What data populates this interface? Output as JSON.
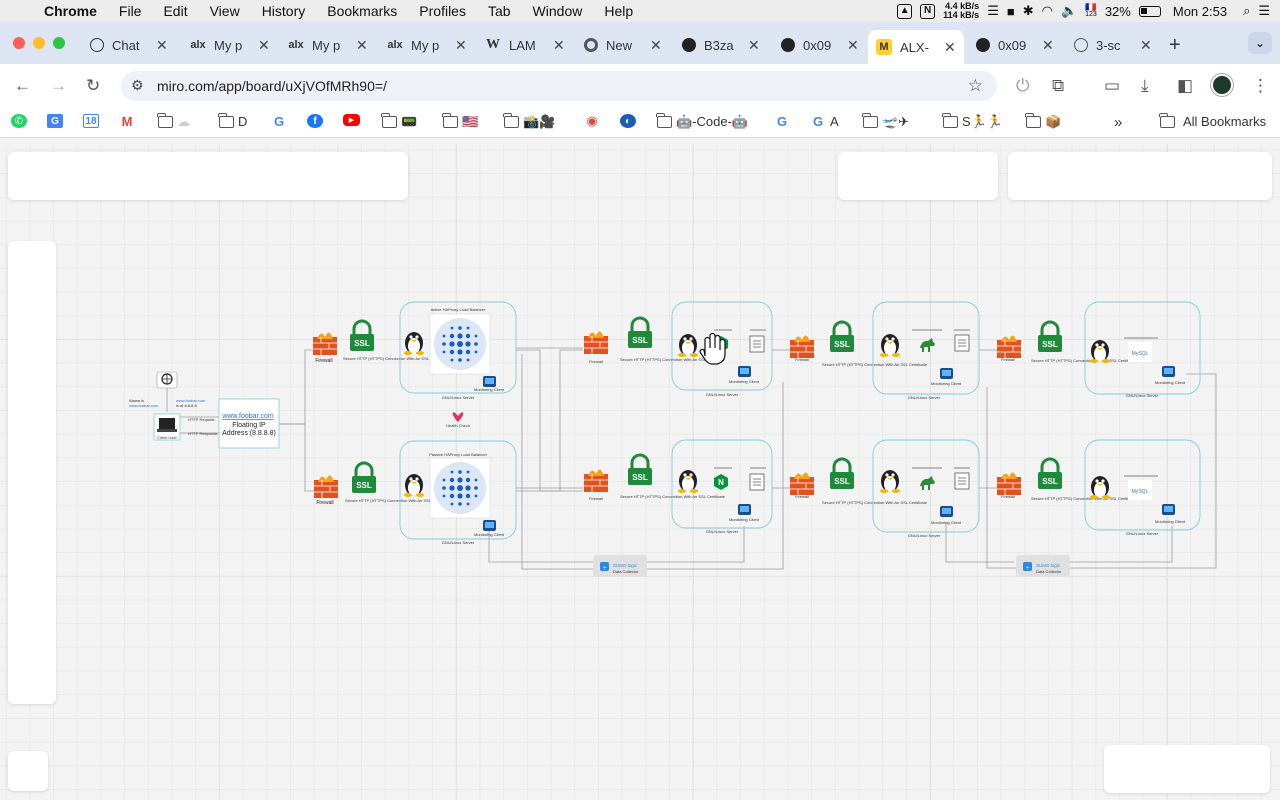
{
  "menubar": {
    "app": "Chrome",
    "items": [
      "File",
      "Edit",
      "View",
      "History",
      "Bookmarks",
      "Profiles",
      "Tab",
      "Window",
      "Help"
    ],
    "net_up": "4.4 kB/s",
    "net_down": "114 kB/s",
    "flag_badge": "123",
    "battery": "32%",
    "clock": "Mon 2:53"
  },
  "tabs": [
    {
      "title": "Chat",
      "icon": "chatgpt-icon"
    },
    {
      "title": "My p",
      "icon": "alx-icon"
    },
    {
      "title": "My p",
      "icon": "alx-icon"
    },
    {
      "title": "My p",
      "icon": "alx-icon"
    },
    {
      "title": "LAM",
      "icon": "wikipedia-icon"
    },
    {
      "title": "New",
      "icon": "chrome-icon"
    },
    {
      "title": "B3za",
      "icon": "github-icon"
    },
    {
      "title": "0x09",
      "icon": "github-icon"
    },
    {
      "title": "ALX-",
      "icon": "miro-icon",
      "active": true
    },
    {
      "title": "0x09",
      "icon": "github-icon"
    },
    {
      "title": "3-sc",
      "icon": "globe-icon"
    }
  ],
  "omnibox": {
    "url": "miro.com/app/board/uXjVOfMRh90=/"
  },
  "bookmarks": [
    {
      "label": "",
      "icon": "whatsapp-icon"
    },
    {
      "label": "",
      "icon": "google-translate-icon"
    },
    {
      "label": "",
      "icon": "google-calendar-icon"
    },
    {
      "label": "",
      "icon": "gmail-icon"
    },
    {
      "label": "☁",
      "icon": "folder-icon"
    },
    {
      "label": "D",
      "icon": "folder-icon"
    },
    {
      "label": "",
      "icon": "google-icon"
    },
    {
      "label": "",
      "icon": "facebook-icon"
    },
    {
      "label": "",
      "icon": "youtube-icon"
    },
    {
      "label": "📟",
      "icon": "folder-icon"
    },
    {
      "label": "🇺🇸",
      "icon": "folder-icon"
    },
    {
      "label": "📸🎥",
      "icon": "folder-icon"
    },
    {
      "label": "",
      "icon": "maps-icon"
    },
    {
      "label": "",
      "icon": "bookmark-icon"
    },
    {
      "label": "🤖-Code-🤖",
      "icon": "folder-icon"
    },
    {
      "label": "",
      "icon": "google-icon"
    },
    {
      "label": "A",
      "icon": "google-icon"
    },
    {
      "label": "🛫✈",
      "icon": "folder-icon"
    },
    {
      "label": "S🏃🏃",
      "icon": "folder-icon"
    },
    {
      "label": "📦",
      "icon": "folder-icon"
    }
  ],
  "all_bookmarks": "All Bookmarks",
  "diagram": {
    "client_label": "Client User",
    "whois_label": "Wawa is",
    "whois_link": "www.foobar.com",
    "dns_link": "www.foobar.com",
    "dns_ip": "is at 8.8.8.8",
    "http_request": "HTTP Request",
    "http_response": "HTTP Response",
    "floating_ip_link": "www.foobar.com",
    "floating_ip_line1": "Floating IP",
    "floating_ip_line2": "Address (8.8.8.8)",
    "firewall": "Firewall",
    "ssl": "SSL",
    "ssl_caption": "Secure HTTP (HTTPS) Connection With An SSL Certificate",
    "lb_active": "Active HAProxy Load Balancer",
    "lb_passive": "Passive HAProxy Load Balancer",
    "health_check": "Health Check",
    "gnu_linux_server": "GNU/Linux Server",
    "monitoring_client": "Monitoring Client",
    "sumologic": "SUMO logic",
    "data_collector": "Data Collector",
    "mysql": "MySQL",
    "nginx": "N"
  }
}
